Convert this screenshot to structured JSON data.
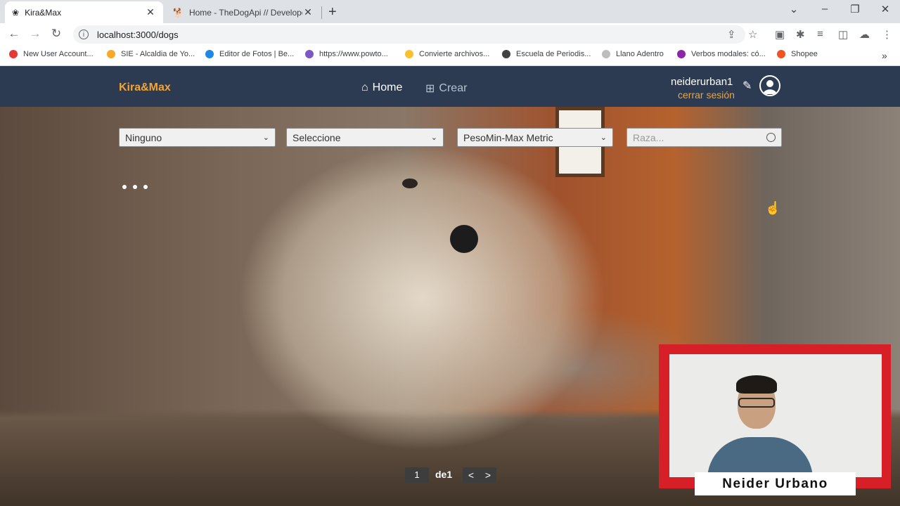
{
  "browser": {
    "tabs": [
      {
        "title": "Kira&Max",
        "active": true
      },
      {
        "title": "Home - TheDogApi // Developer",
        "active": false
      }
    ],
    "url": "localhost:3000/dogs",
    "bookmarks": [
      {
        "label": "New User Account...",
        "color": "#e53935"
      },
      {
        "label": "SIE - Alcaldia de Yo...",
        "color": "#f9a825"
      },
      {
        "label": "Editor de Fotos | Be...",
        "color": "#1e88e5"
      },
      {
        "label": "https://www.powto...",
        "color": "#7e57c2"
      },
      {
        "label": "Convierte archivos...",
        "color": "#fbc02d"
      },
      {
        "label": "Escuela de Periodis...",
        "color": "#424242"
      },
      {
        "label": "Llano Adentro",
        "color": "#bdbdbd"
      },
      {
        "label": "Verbos modales: có...",
        "color": "#8e24aa"
      },
      {
        "label": "Shopee",
        "color": "#ef5322"
      }
    ]
  },
  "navbar": {
    "brand": "Kira&Max",
    "links": [
      {
        "label": "Home",
        "icon": "home-icon",
        "active": true
      },
      {
        "label": "Crear",
        "icon": "plus-square-icon",
        "active": false
      }
    ],
    "username": "neiderurban1",
    "logout": "cerrar sesión"
  },
  "filters": [
    {
      "value": "Ninguno"
    },
    {
      "value": "Seleccione"
    },
    {
      "value": "PesoMin-Max Metric"
    }
  ],
  "search": {
    "placeholder": "Raza..."
  },
  "pagination": {
    "current": "1",
    "of_label": "de",
    "total": "1",
    "prev": "<",
    "next": ">"
  },
  "webcam": {
    "name": "Neider Urbano"
  },
  "colors": {
    "navbar": "#2c3a52",
    "accent": "#f0a535",
    "webcam_frame": "#d61f26"
  }
}
